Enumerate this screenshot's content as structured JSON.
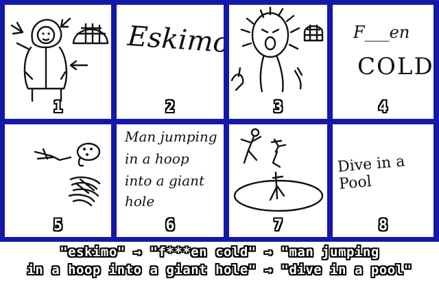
{
  "panels": [
    {
      "number": "1",
      "kind": "drawing",
      "subject": "eskimo-with-igloo"
    },
    {
      "number": "2",
      "kind": "writing",
      "text": "Eskimo"
    },
    {
      "number": "3",
      "kind": "drawing",
      "subject": "shivering-man-with-igloo"
    },
    {
      "number": "4",
      "kind": "writing",
      "text_top": "F___en",
      "text_bottom": "COLD"
    },
    {
      "number": "5",
      "kind": "drawing",
      "subject": "scribbled-figure"
    },
    {
      "number": "6",
      "kind": "writing",
      "lines": [
        "Man jumping",
        "in a hoop",
        "into a giant",
        "hole"
      ]
    },
    {
      "number": "7",
      "kind": "drawing",
      "subject": "people-jumping-into-pool"
    },
    {
      "number": "8",
      "kind": "writing",
      "text": "Dive in a Pool"
    }
  ],
  "caption": {
    "line1": "\"eskimo\" → \"f***en cold\" → \"man jumping",
    "line2": "in a hoop into a giant hole\" → \"dive in a pool\""
  },
  "colors": {
    "frame": "#1418a8",
    "panel": "#ffffff",
    "ink": "#111111"
  }
}
